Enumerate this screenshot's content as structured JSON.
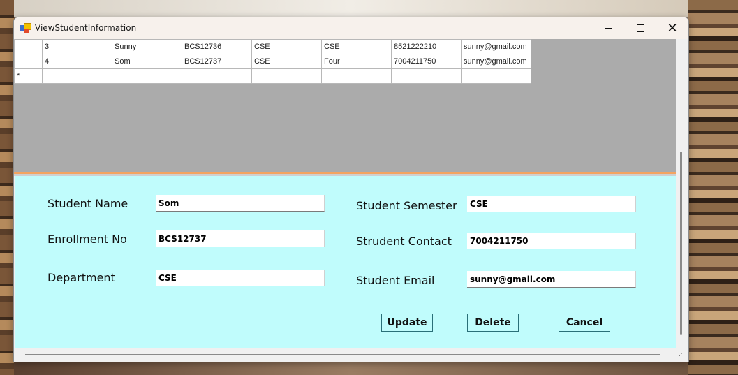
{
  "window": {
    "title": "ViewStudentInformation"
  },
  "grid": {
    "rows": [
      {
        "id": "3",
        "name": "Sunny",
        "enroll": "BCS12736",
        "dept": "CSE",
        "semester": "CSE",
        "contact": "8521222210",
        "email": "sunny@gmail.com"
      },
      {
        "id": "4",
        "name": "Som",
        "enroll": "BCS12737",
        "dept": "CSE",
        "semester": "Four",
        "contact": "7004211750",
        "email": "sunny@gmail.com"
      }
    ],
    "new_row_marker": "*"
  },
  "form": {
    "student_name_label": "Student Name",
    "student_name_value": "Som",
    "enrollment_label": "Enrollment No",
    "enrollment_value": "BCS12737",
    "department_label": "Department",
    "department_value": "CSE",
    "semester_label": "Student Semester",
    "semester_value": "CSE",
    "contact_label": "Strudent Contact",
    "contact_value": "7004211750",
    "email_label": "Student Email",
    "email_value": "sunny@gmail.com"
  },
  "buttons": {
    "update": "Update",
    "delete": "Delete",
    "cancel": "Cancel"
  },
  "colors": {
    "form_bg": "#c0fcfc",
    "grid_bg": "#ababab",
    "divider": "#f4a460"
  }
}
